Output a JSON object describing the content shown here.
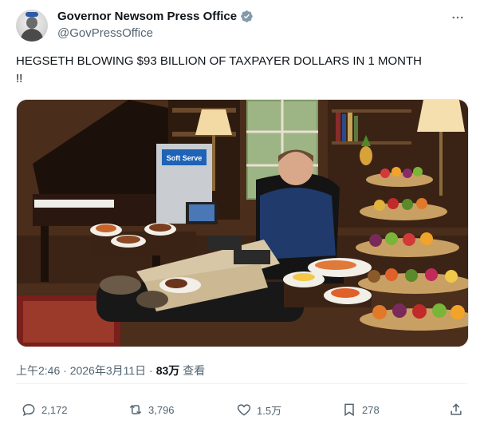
{
  "account": {
    "display_name": "Governor Newsom Press Office",
    "handle": "@GovPressOffice"
  },
  "tweet": {
    "text_line1": "HEGSETH BLOWING $93 BILLION OF TAXPAYER DOLLARS IN 1 MONTH",
    "text_line2": "!!"
  },
  "media": {
    "machine_label": "Soft Serve"
  },
  "meta": {
    "timestamp": "上午2:46 · 2026年3月11日 ·",
    "views_count": "83万",
    "views_label": "查看"
  },
  "actions": {
    "reply_count": "2,172",
    "repost_count": "3,796",
    "like_count": "1.5万",
    "bookmark_count": "278"
  },
  "colors": {
    "verified": "#829aab",
    "text_secondary": "#536471",
    "text_primary": "#0f1419"
  },
  "icons": [
    "verified-badge-icon",
    "more-icon",
    "reply-icon",
    "repost-icon",
    "like-icon",
    "bookmark-icon",
    "share-icon"
  ]
}
